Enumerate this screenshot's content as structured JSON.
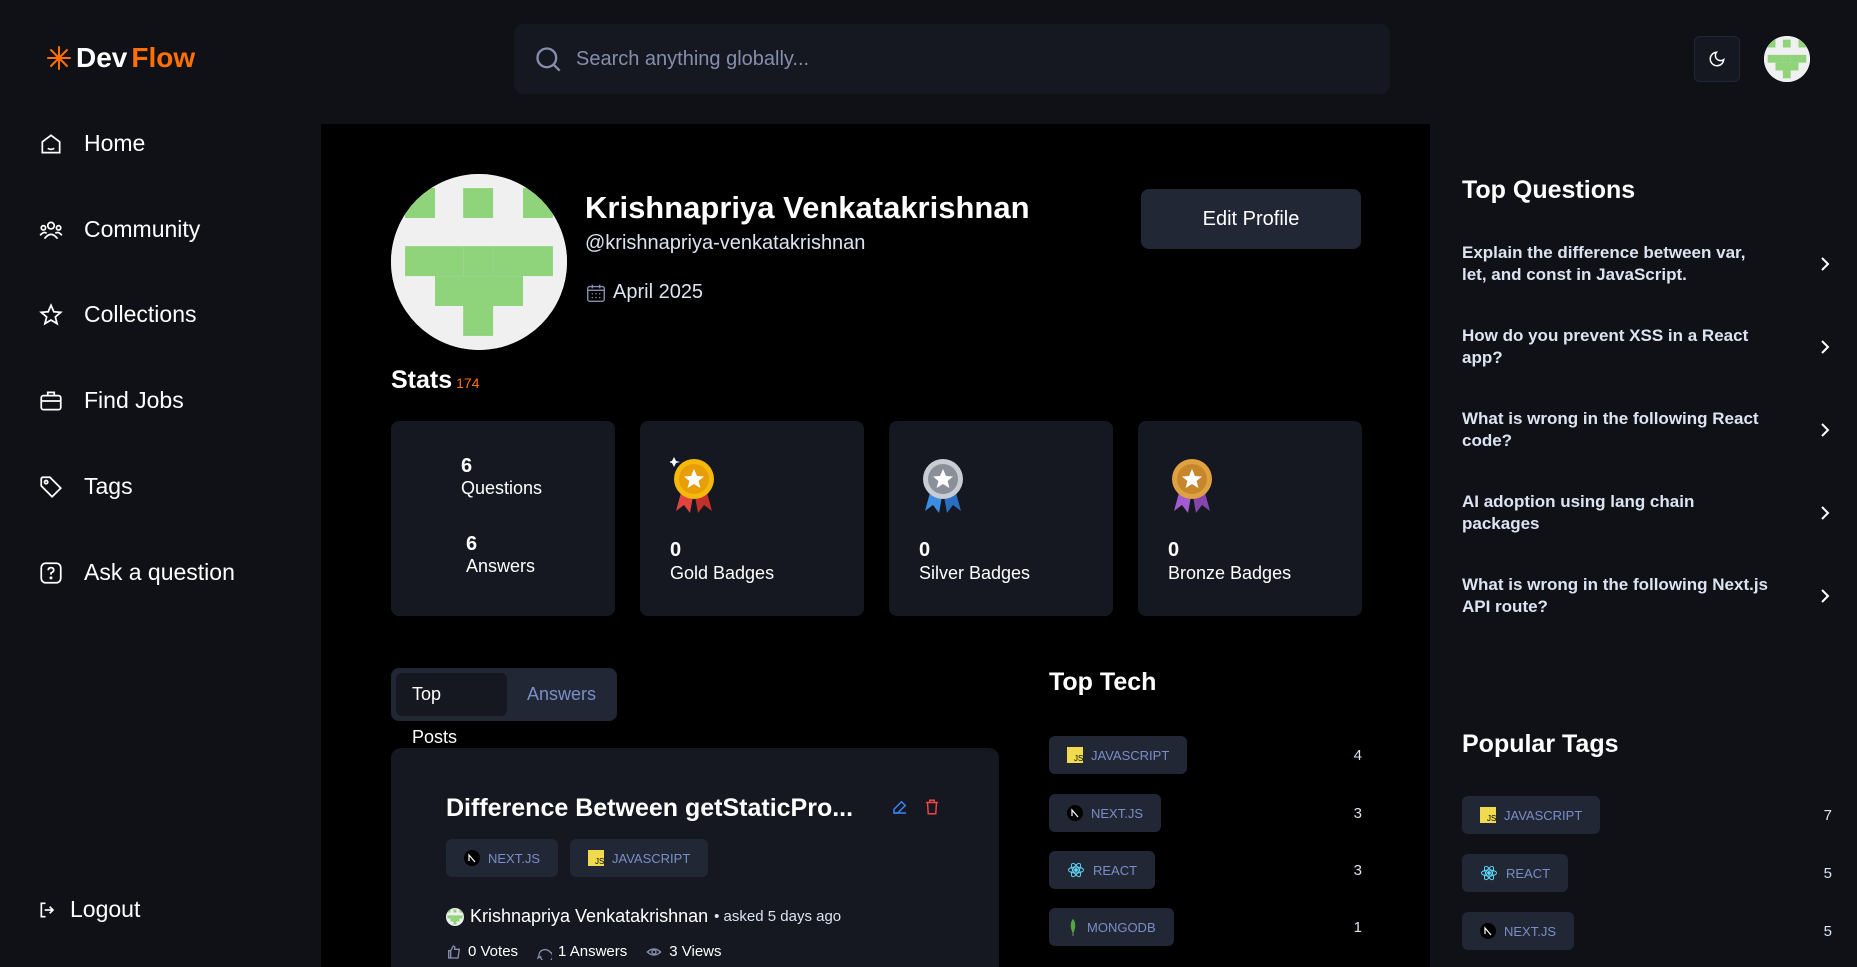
{
  "app": {
    "logo_dev": "Dev",
    "logo_flow": "Flow"
  },
  "search": {
    "placeholder": "Search anything globally..."
  },
  "nav": {
    "items": [
      {
        "label": "Home",
        "icon": "home-icon"
      },
      {
        "label": "Community",
        "icon": "users-icon"
      },
      {
        "label": "Collections",
        "icon": "star-icon"
      },
      {
        "label": "Find Jobs",
        "icon": "briefcase-icon"
      },
      {
        "label": "Tags",
        "icon": "tag-icon"
      },
      {
        "label": "Ask a question",
        "icon": "question-icon"
      }
    ],
    "logout": "Logout"
  },
  "profile": {
    "name": "Krishnapriya Venkatakrishnan",
    "username": "@krishnapriya-venkatakrishnan",
    "joined": "April 2025",
    "edit_label": "Edit Profile"
  },
  "stats": {
    "title": "Stats",
    "reputation": "174",
    "questions": {
      "value": "6",
      "label": "Questions"
    },
    "answers": {
      "value": "6",
      "label": "Answers"
    },
    "gold": {
      "value": "0",
      "label": "Gold Badges"
    },
    "silver": {
      "value": "0",
      "label": "Silver Badges"
    },
    "bronze": {
      "value": "0",
      "label": "Bronze Badges"
    }
  },
  "tabs": {
    "top_posts": "Top Posts",
    "answers": "Answers"
  },
  "post": {
    "title": "Difference Between getStaticPro...",
    "tags": [
      "NEXT.JS",
      "JAVASCRIPT"
    ],
    "author": "Krishnapriya Venkatakrishnan",
    "asked": "• asked 5 days ago",
    "votes": "0 Votes",
    "answers": "1 Answers",
    "views": "3 Views"
  },
  "top_tech": {
    "title": "Top Tech",
    "items": [
      {
        "name": "JAVASCRIPT",
        "count": "4"
      },
      {
        "name": "NEXT.JS",
        "count": "3"
      },
      {
        "name": "REACT",
        "count": "3"
      },
      {
        "name": "MONGODB",
        "count": "1"
      }
    ]
  },
  "right": {
    "top_questions_title": "Top Questions",
    "questions": [
      "Explain the difference between var, let, and const in JavaScript.",
      "How do you prevent XSS in a React app?",
      "What is wrong in the following React code?",
      "AI adoption using lang chain packages",
      "What is wrong in the following Next.js API route?"
    ],
    "popular_tags_title": "Popular Tags",
    "tags": [
      {
        "name": "JAVASCRIPT",
        "count": "7"
      },
      {
        "name": "REACT",
        "count": "5"
      },
      {
        "name": "NEXT.JS",
        "count": "5"
      }
    ]
  },
  "colors": {
    "accent": "#ff7000",
    "tag_text": "#7b8ec8",
    "card": "#151821"
  }
}
